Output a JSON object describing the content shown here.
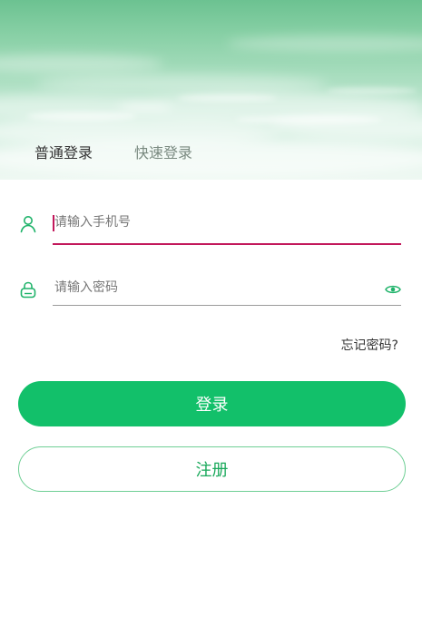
{
  "tabs": [
    {
      "label": "普通登录",
      "active": true
    },
    {
      "label": "快速登录",
      "active": false
    }
  ],
  "phone_field": {
    "placeholder": "请输入手机号",
    "value": ""
  },
  "password_field": {
    "placeholder": "请输入密码",
    "value": ""
  },
  "icons": {
    "phone": "user-icon",
    "password": "lock-icon",
    "toggle_password": "eye-icon"
  },
  "forgot_password": "忘记密码?",
  "buttons": {
    "login": "登录",
    "register": "注册"
  },
  "colors": {
    "primary": "#12c06a",
    "focus_underline": "#c2185b",
    "register_border": "#6fcf95",
    "header_top": "#6cc291"
  }
}
